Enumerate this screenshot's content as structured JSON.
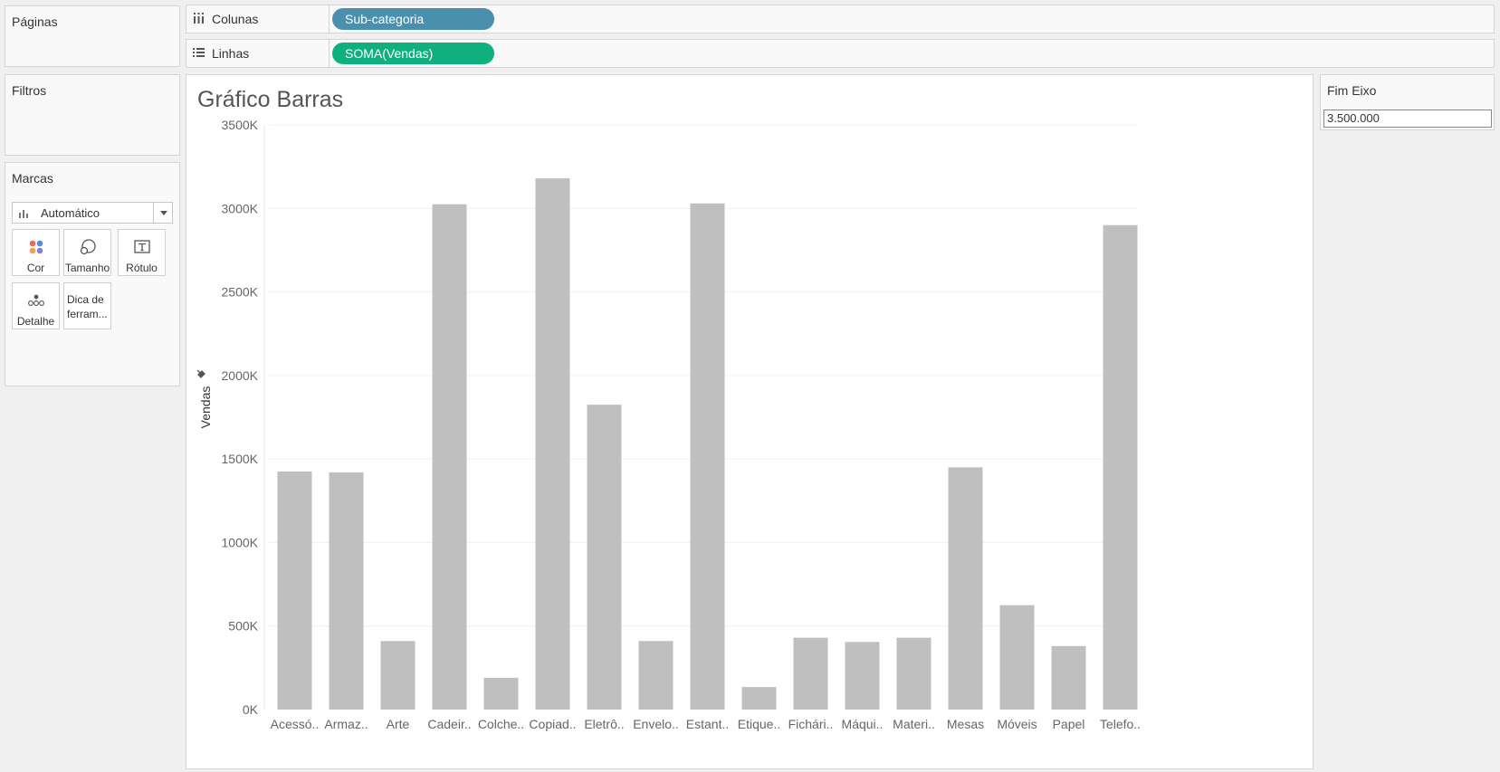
{
  "panels": {
    "pages_title": "Páginas",
    "filters_title": "Filtros",
    "marks_title": "Marcas"
  },
  "marks": {
    "dropdown_value": "Automático",
    "buttons": [
      {
        "label": "Cor",
        "icon": "color-dots-icon"
      },
      {
        "label": "Tamanho",
        "icon": "size-icon"
      },
      {
        "label": "Rótulo",
        "icon": "label-icon"
      },
      {
        "label": "Detalhe",
        "icon": "detail-icon"
      },
      {
        "label": "Dica de ferram...",
        "icon": "tooltip-icon"
      }
    ]
  },
  "shelves": {
    "columns_label": "Colunas",
    "columns_pill": "Sub-categoria",
    "rows_label": "Linhas",
    "rows_pill": "SOMA(Vendas)"
  },
  "parameter": {
    "title": "Fim Eixo",
    "value": "3.500.000"
  },
  "colors": {
    "bar": "#bfbfbf",
    "columns_pill": "#4a90ae",
    "rows_pill": "#10b07e"
  },
  "chart_data": {
    "type": "bar",
    "title": "Gráfico Barras",
    "xlabel": "",
    "ylabel": "Vendas",
    "categories": [
      "Acessó..",
      "Armaz..",
      "Arte",
      "Cadeir..",
      "Colche..",
      "Copiad..",
      "Eletrô..",
      "Envelo..",
      "Estant..",
      "Etique..",
      "Fichári..",
      "Máqui..",
      "Materi..",
      "Mesas",
      "Móveis",
      "Papel",
      "Telefo.."
    ],
    "values": [
      1425000,
      1420000,
      410000,
      3025000,
      190000,
      3180000,
      1825000,
      410000,
      3030000,
      135000,
      430000,
      405000,
      430000,
      1450000,
      625000,
      380000,
      2900000
    ],
    "ylim": [
      0,
      3500000
    ],
    "yticks": [
      0,
      500000,
      1000000,
      1500000,
      2000000,
      2500000,
      3000000,
      3500000
    ],
    "ytick_labels": [
      "0K",
      "500K",
      "1000K",
      "1500K",
      "2000K",
      "2500K",
      "3000K",
      "3500K"
    ],
    "grid": true
  }
}
